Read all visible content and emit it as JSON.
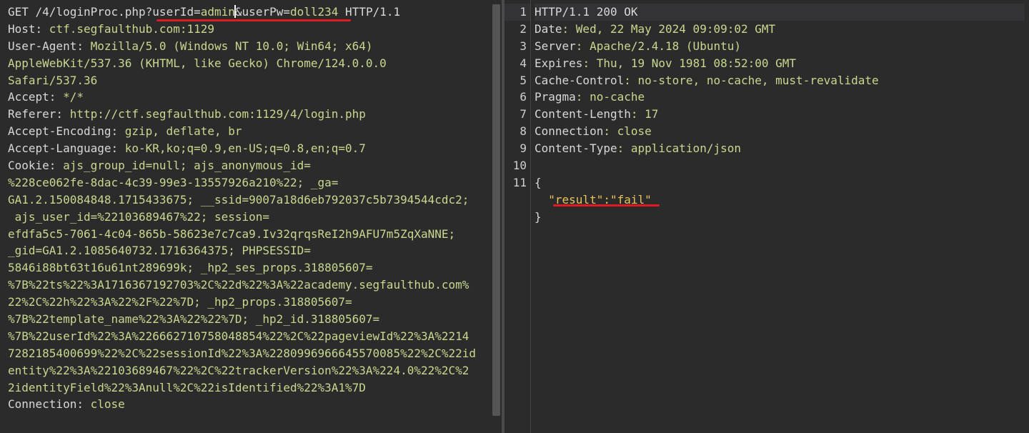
{
  "request": {
    "lines": [
      [
        "GET /4/loginProc.php?",
        "userId",
        "=",
        "admin",
        "&",
        "userPw",
        "=",
        "doll234",
        " HTTP/1.1"
      ],
      "Host: ctf.segfaulthub.com:1129",
      "User-Agent: Mozilla/5.0 (Windows NT 10.0; Win64; x64)",
      "AppleWebKit/537.36 (KHTML, like Gecko) Chrome/124.0.0.0",
      "Safari/537.36",
      "Accept: */*",
      "Referer: http://ctf.segfaulthub.com:1129/4/login.php",
      "Accept-Encoding: gzip, deflate, br",
      "Accept-Language: ko-KR,ko;q=0.9,en-US;q=0.8,en;q=0.7",
      "Cookie: ajs_group_id=null; ajs_anonymous_id=",
      "%228ce062fe-8dac-4c39-99e3-13557926a210%22; _ga=",
      "GA1.2.150084848.1715433675; __ssid=9007a18d6eb792037c5b7394544cdc2;",
      " ajs_user_id=%22103689467%22; session=",
      "efdfa5c5-7061-4c04-865b-58623e7c7ca9.Iv32qrqsReI2h9AFU7m5ZqXaNNE;",
      "_gid=GA1.2.1085640732.1716364375; PHPSESSID=",
      "5846i88bt63t16u61nt289699k; _hp2_ses_props.318805607=",
      "%7B%22ts%22%3A1716367192703%2C%22d%22%3A%22academy.segfaulthub.com%",
      "22%2C%22h%22%3A%22%2F%22%7D; _hp2_props.318805607=",
      "%7B%22template_name%22%3A%22%22%7D; _hp2_id.318805607=",
      "%7B%22userId%22%3A%226662710758048854%22%2C%22pageviewId%22%3A%2214",
      "7282185400699%22%2C%22sessionId%22%3A%2280996966645570085%22%2C%22id",
      "entity%22%3A%22103689467%22%2C%22trackerVersion%22%3A%224.0%22%2C%2",
      "2identityField%22%3Anull%2C%22isIdentified%22%3A1%7D",
      "Connection: close"
    ]
  },
  "response": {
    "line_numbers": [
      "1",
      "2",
      "3",
      "4",
      "5",
      "6",
      "7",
      "8",
      "9",
      "10",
      "11"
    ],
    "lines": [
      "HTTP/1.1 200 OK",
      [
        "Date",
        ": Wed, 22 May 2024 09:09:02 GMT"
      ],
      [
        "Server",
        ": Apache/2.4.18 (Ubuntu)"
      ],
      [
        "Expires",
        ": Thu, 19 Nov 1981 08:52:00 GMT"
      ],
      [
        "Cache-Control",
        ": no-store, no-cache, must-revalidate"
      ],
      [
        "Pragma",
        ": no-cache"
      ],
      [
        "Content-Length",
        ": 17"
      ],
      [
        "Connection",
        ": close"
      ],
      [
        "Content-Type",
        ": application/json"
      ],
      "",
      "{",
      "  \"result\":\"fail\"",
      "}"
    ]
  },
  "colors": {
    "accent": "#e8671e",
    "highlight": "#e01b24"
  }
}
